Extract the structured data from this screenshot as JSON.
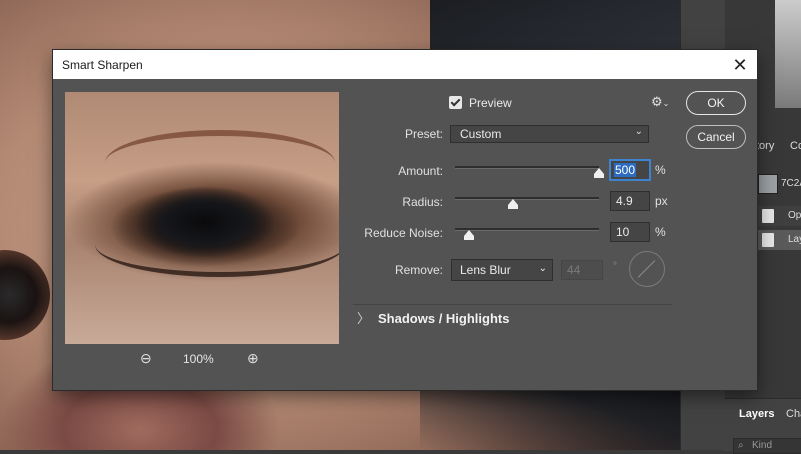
{
  "dialog": {
    "title": "Smart Sharpen",
    "close_glyph": "✕",
    "preview_label": "Preview",
    "preview_checked": true,
    "settings_icon": "gear-icon",
    "preset_label": "Preset:",
    "preset_value": "Custom",
    "amount_label": "Amount:",
    "amount_value": "500",
    "amount_unit": "%",
    "amount_fraction": 1.0,
    "radius_label": "Radius:",
    "radius_value": "4.9",
    "radius_unit": "px",
    "radius_fraction": 0.4,
    "noise_label": "Reduce Noise:",
    "noise_value": "10",
    "noise_unit": "%",
    "noise_fraction": 0.1,
    "remove_label": "Remove:",
    "remove_value": "Lens Blur",
    "angle_value": "44",
    "angle_unit": "°",
    "shadows_label": "Shadows / Highlights",
    "ok_label": "OK",
    "cancel_label": "Cancel",
    "zoom_out_glyph": "⊖",
    "zoom_in_glyph": "⊕",
    "zoom_level": "100%"
  },
  "right_panel": {
    "tab_history": "tory",
    "tab_second": "Co",
    "snapshot_label": "7C2A",
    "history_item_1": "Op",
    "history_item_2": "Lay",
    "layers_tab": "Layers",
    "channels_tab": "Cha",
    "search_placeholder": "Kind"
  }
}
